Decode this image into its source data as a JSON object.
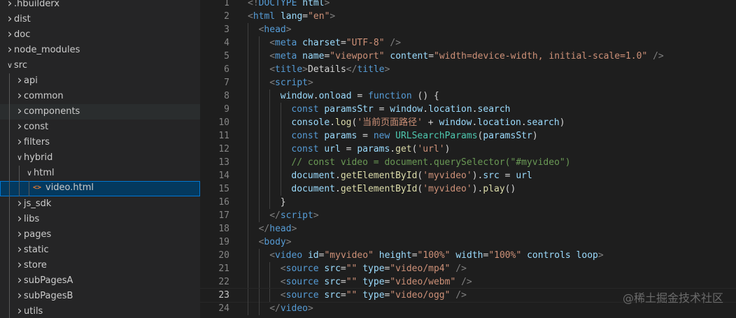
{
  "explorer": {
    "items": [
      {
        "label": ".hbuilderx",
        "depth": 0,
        "kind": "folder",
        "expanded": false
      },
      {
        "label": "dist",
        "depth": 0,
        "kind": "folder",
        "expanded": false
      },
      {
        "label": "doc",
        "depth": 0,
        "kind": "folder",
        "expanded": false
      },
      {
        "label": "node_modules",
        "depth": 0,
        "kind": "folder",
        "expanded": false
      },
      {
        "label": "src",
        "depth": 0,
        "kind": "folder",
        "expanded": true
      },
      {
        "label": "api",
        "depth": 1,
        "kind": "folder",
        "expanded": false
      },
      {
        "label": "common",
        "depth": 1,
        "kind": "folder",
        "expanded": false
      },
      {
        "label": "components",
        "depth": 1,
        "kind": "folder",
        "expanded": false,
        "hover": true
      },
      {
        "label": "const",
        "depth": 1,
        "kind": "folder",
        "expanded": false
      },
      {
        "label": "filters",
        "depth": 1,
        "kind": "folder",
        "expanded": false
      },
      {
        "label": "hybrid",
        "depth": 1,
        "kind": "folder",
        "expanded": true
      },
      {
        "label": "html",
        "depth": 2,
        "kind": "folder",
        "expanded": true
      },
      {
        "label": "video.html",
        "depth": 3,
        "kind": "file",
        "icon": "<>",
        "selected": true
      },
      {
        "label": "js_sdk",
        "depth": 1,
        "kind": "folder",
        "expanded": false
      },
      {
        "label": "libs",
        "depth": 1,
        "kind": "folder",
        "expanded": false
      },
      {
        "label": "pages",
        "depth": 1,
        "kind": "folder",
        "expanded": false
      },
      {
        "label": "static",
        "depth": 1,
        "kind": "folder",
        "expanded": false
      },
      {
        "label": "store",
        "depth": 1,
        "kind": "folder",
        "expanded": false
      },
      {
        "label": "subPagesA",
        "depth": 1,
        "kind": "folder",
        "expanded": false
      },
      {
        "label": "subPagesB",
        "depth": 1,
        "kind": "folder",
        "expanded": false
      },
      {
        "label": "utils",
        "depth": 1,
        "kind": "folder",
        "expanded": false
      }
    ]
  },
  "editor": {
    "current_line": 23,
    "lines": [
      {
        "n": "1",
        "indent": 0,
        "t": [
          [
            "punct",
            "<!"
          ],
          [
            "tag",
            "DOCTYPE"
          ],
          [
            "text",
            " "
          ],
          [
            "attr",
            "html"
          ],
          [
            "punct",
            ">"
          ]
        ]
      },
      {
        "n": "2",
        "indent": 0,
        "t": [
          [
            "punct",
            "<"
          ],
          [
            "tag",
            "html"
          ],
          [
            "text",
            " "
          ],
          [
            "attr",
            "lang"
          ],
          [
            "text",
            "="
          ],
          [
            "str",
            "\"en\""
          ],
          [
            "punct",
            ">"
          ]
        ]
      },
      {
        "n": "3",
        "indent": 1,
        "t": [
          [
            "punct",
            "<"
          ],
          [
            "tag",
            "head"
          ],
          [
            "punct",
            ">"
          ]
        ]
      },
      {
        "n": "4",
        "indent": 2,
        "t": [
          [
            "punct",
            "<"
          ],
          [
            "tag",
            "meta"
          ],
          [
            "text",
            " "
          ],
          [
            "attr",
            "charset"
          ],
          [
            "text",
            "="
          ],
          [
            "str",
            "\"UTF-8\""
          ],
          [
            "text",
            " "
          ],
          [
            "punct",
            "/>"
          ]
        ]
      },
      {
        "n": "5",
        "indent": 2,
        "t": [
          [
            "punct",
            "<"
          ],
          [
            "tag",
            "meta"
          ],
          [
            "text",
            " "
          ],
          [
            "attr",
            "name"
          ],
          [
            "text",
            "="
          ],
          [
            "str",
            "\"viewport\""
          ],
          [
            "text",
            " "
          ],
          [
            "attr",
            "content"
          ],
          [
            "text",
            "="
          ],
          [
            "str",
            "\"width=device-width, initial-scale=1.0\""
          ],
          [
            "text",
            " "
          ],
          [
            "punct",
            "/>"
          ]
        ]
      },
      {
        "n": "6",
        "indent": 2,
        "t": [
          [
            "punct",
            "<"
          ],
          [
            "tag",
            "title"
          ],
          [
            "punct",
            ">"
          ],
          [
            "text",
            "Details"
          ],
          [
            "punct",
            "</"
          ],
          [
            "tag",
            "title"
          ],
          [
            "punct",
            ">"
          ]
        ]
      },
      {
        "n": "7",
        "indent": 2,
        "t": [
          [
            "punct",
            "<"
          ],
          [
            "tag",
            "script"
          ],
          [
            "punct",
            ">"
          ]
        ]
      },
      {
        "n": "8",
        "indent": 3,
        "t": [
          [
            "var",
            "window"
          ],
          [
            "plain",
            "."
          ],
          [
            "var",
            "onload"
          ],
          [
            "plain",
            " = "
          ],
          [
            "kw",
            "function"
          ],
          [
            "plain",
            " () {"
          ]
        ]
      },
      {
        "n": "9",
        "indent": 4,
        "t": [
          [
            "kw",
            "const"
          ],
          [
            "plain",
            " "
          ],
          [
            "var",
            "paramsStr"
          ],
          [
            "plain",
            " = "
          ],
          [
            "var",
            "window"
          ],
          [
            "plain",
            "."
          ],
          [
            "var",
            "location"
          ],
          [
            "plain",
            "."
          ],
          [
            "var",
            "search"
          ]
        ]
      },
      {
        "n": "10",
        "indent": 4,
        "t": [
          [
            "var",
            "console"
          ],
          [
            "plain",
            "."
          ],
          [
            "func",
            "log"
          ],
          [
            "plain",
            "("
          ],
          [
            "str",
            "'当前页面路径'"
          ],
          [
            "plain",
            " + "
          ],
          [
            "var",
            "window"
          ],
          [
            "plain",
            "."
          ],
          [
            "var",
            "location"
          ],
          [
            "plain",
            "."
          ],
          [
            "var",
            "search"
          ],
          [
            "plain",
            ")"
          ]
        ]
      },
      {
        "n": "11",
        "indent": 4,
        "t": [
          [
            "kw",
            "const"
          ],
          [
            "plain",
            " "
          ],
          [
            "var",
            "params"
          ],
          [
            "plain",
            " = "
          ],
          [
            "kw",
            "new"
          ],
          [
            "plain",
            " "
          ],
          [
            "class",
            "URLSearchParams"
          ],
          [
            "plain",
            "("
          ],
          [
            "var",
            "paramsStr"
          ],
          [
            "plain",
            ")"
          ]
        ]
      },
      {
        "n": "12",
        "indent": 4,
        "t": [
          [
            "kw",
            "const"
          ],
          [
            "plain",
            " "
          ],
          [
            "var",
            "url"
          ],
          [
            "plain",
            " = "
          ],
          [
            "var",
            "params"
          ],
          [
            "plain",
            "."
          ],
          [
            "func",
            "get"
          ],
          [
            "plain",
            "("
          ],
          [
            "str",
            "'url'"
          ],
          [
            "plain",
            ")"
          ]
        ]
      },
      {
        "n": "13",
        "indent": 4,
        "t": [
          [
            "comment",
            "// const video = document.querySelector(\"#myvideo\")"
          ]
        ]
      },
      {
        "n": "14",
        "indent": 4,
        "t": [
          [
            "var",
            "document"
          ],
          [
            "plain",
            "."
          ],
          [
            "func",
            "getElementById"
          ],
          [
            "plain",
            "("
          ],
          [
            "str",
            "'myvideo'"
          ],
          [
            "plain",
            ")."
          ],
          [
            "var",
            "src"
          ],
          [
            "plain",
            " = "
          ],
          [
            "var",
            "url"
          ]
        ]
      },
      {
        "n": "15",
        "indent": 4,
        "t": [
          [
            "var",
            "document"
          ],
          [
            "plain",
            "."
          ],
          [
            "func",
            "getElementById"
          ],
          [
            "plain",
            "("
          ],
          [
            "str",
            "'myvideo'"
          ],
          [
            "plain",
            ")."
          ],
          [
            "func",
            "play"
          ],
          [
            "plain",
            "()"
          ]
        ]
      },
      {
        "n": "16",
        "indent": 3,
        "t": [
          [
            "plain",
            "}"
          ]
        ]
      },
      {
        "n": "17",
        "indent": 2,
        "t": [
          [
            "punct",
            "</"
          ],
          [
            "tag",
            "script"
          ],
          [
            "punct",
            ">"
          ]
        ]
      },
      {
        "n": "18",
        "indent": 1,
        "t": [
          [
            "punct",
            "</"
          ],
          [
            "tag",
            "head"
          ],
          [
            "punct",
            ">"
          ]
        ]
      },
      {
        "n": "19",
        "indent": 1,
        "t": [
          [
            "punct",
            "<"
          ],
          [
            "tag",
            "body"
          ],
          [
            "punct",
            ">"
          ]
        ]
      },
      {
        "n": "20",
        "indent": 2,
        "t": [
          [
            "punct",
            "<"
          ],
          [
            "tag",
            "video"
          ],
          [
            "text",
            " "
          ],
          [
            "attr",
            "id"
          ],
          [
            "text",
            "="
          ],
          [
            "str",
            "\"myvideo\""
          ],
          [
            "text",
            " "
          ],
          [
            "attr",
            "height"
          ],
          [
            "text",
            "="
          ],
          [
            "str",
            "\"100%\""
          ],
          [
            "text",
            " "
          ],
          [
            "attr",
            "width"
          ],
          [
            "text",
            "="
          ],
          [
            "str",
            "\"100%\""
          ],
          [
            "text",
            " "
          ],
          [
            "attr",
            "controls"
          ],
          [
            "text",
            " "
          ],
          [
            "attr",
            "loop"
          ],
          [
            "punct",
            ">"
          ]
        ]
      },
      {
        "n": "21",
        "indent": 3,
        "t": [
          [
            "punct",
            "<"
          ],
          [
            "tag",
            "source"
          ],
          [
            "text",
            " "
          ],
          [
            "attr",
            "src"
          ],
          [
            "text",
            "="
          ],
          [
            "str",
            "\"\""
          ],
          [
            "text",
            " "
          ],
          [
            "attr",
            "type"
          ],
          [
            "text",
            "="
          ],
          [
            "str",
            "\"video/mp4\""
          ],
          [
            "text",
            " "
          ],
          [
            "punct",
            "/>"
          ]
        ]
      },
      {
        "n": "22",
        "indent": 3,
        "t": [
          [
            "punct",
            "<"
          ],
          [
            "tag",
            "source"
          ],
          [
            "text",
            " "
          ],
          [
            "attr",
            "src"
          ],
          [
            "text",
            "="
          ],
          [
            "str",
            "\"\""
          ],
          [
            "text",
            " "
          ],
          [
            "attr",
            "type"
          ],
          [
            "text",
            "="
          ],
          [
            "str",
            "\"video/webm\""
          ],
          [
            "text",
            " "
          ],
          [
            "punct",
            "/>"
          ]
        ]
      },
      {
        "n": "23",
        "indent": 3,
        "t": [
          [
            "punct",
            "<"
          ],
          [
            "tag",
            "source"
          ],
          [
            "text",
            " "
          ],
          [
            "attr",
            "src"
          ],
          [
            "text",
            "="
          ],
          [
            "str",
            "\"\""
          ],
          [
            "text",
            " "
          ],
          [
            "attr",
            "type"
          ],
          [
            "text",
            "="
          ],
          [
            "str",
            "\"video/ogg\""
          ],
          [
            "text",
            " "
          ],
          [
            "punct",
            "/>"
          ]
        ]
      },
      {
        "n": "24",
        "indent": 2,
        "t": [
          [
            "punct",
            "</"
          ],
          [
            "tag",
            "video"
          ],
          [
            "punct",
            ">"
          ]
        ]
      }
    ]
  },
  "watermark": "@稀土掘金技术社区",
  "colors": {
    "editor_bg": "#1e1e1e",
    "sidebar_bg": "#252526",
    "selection_bg": "#04395e",
    "selection_border": "#0078d4",
    "html_icon": "#e37933"
  },
  "icons": {
    "collapsed": "chevron-right-icon",
    "expanded": "chevron-down-icon",
    "html_file": "html-file-icon"
  }
}
